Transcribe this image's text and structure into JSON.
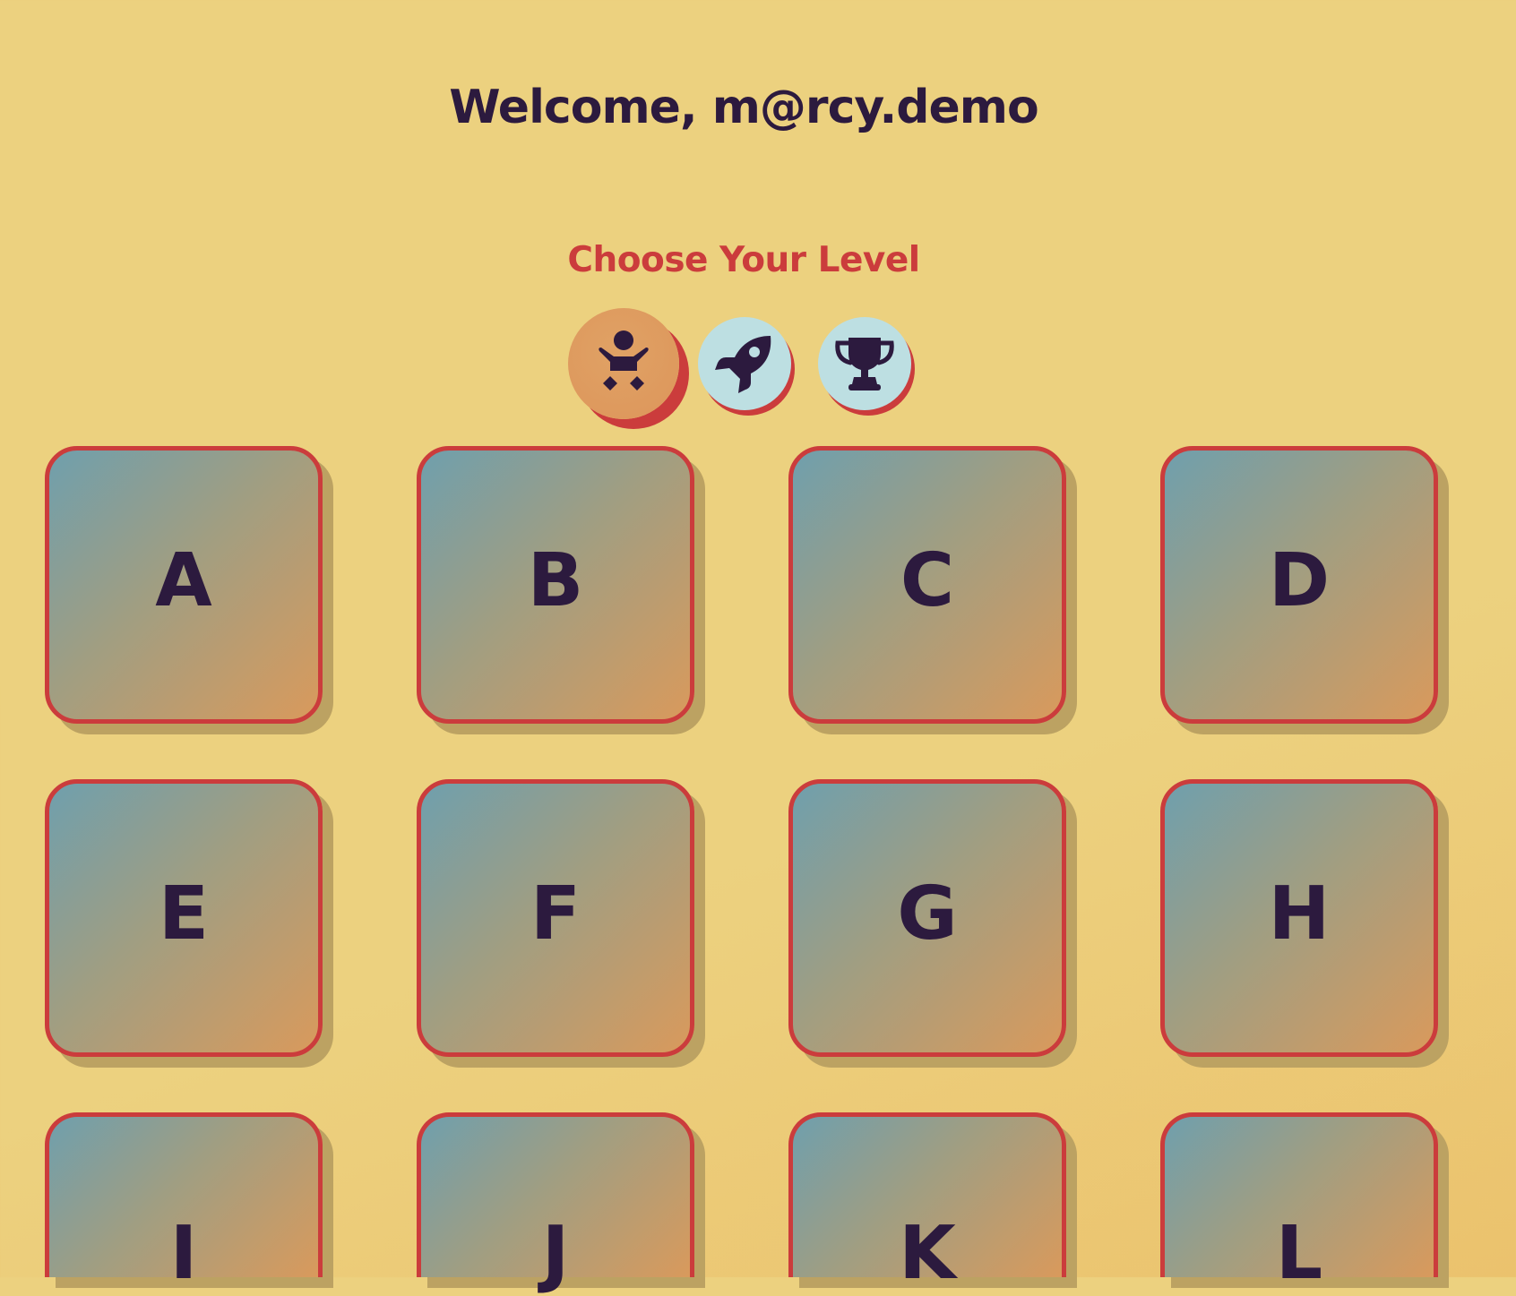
{
  "header": {
    "welcome": "Welcome, m@rcy.demo"
  },
  "levels": {
    "heading": "Choose Your Level",
    "options": [
      {
        "icon": "baby-icon",
        "selected": true
      },
      {
        "icon": "rocket-icon",
        "selected": false
      },
      {
        "icon": "trophy-icon",
        "selected": false
      }
    ]
  },
  "tiles": [
    "A",
    "B",
    "C",
    "D",
    "E",
    "F",
    "G",
    "H",
    "I",
    "J",
    "K",
    "L"
  ],
  "colors": {
    "background": "#ecd17f",
    "text_dark": "#2c1a3e",
    "accent_red": "#cb3c3c",
    "selected_orange": "#dd955a",
    "unselected_blue": "#bddfe2",
    "tile_gradient_start": "#6f9fad",
    "tile_gradient_end": "#d99a5c"
  }
}
